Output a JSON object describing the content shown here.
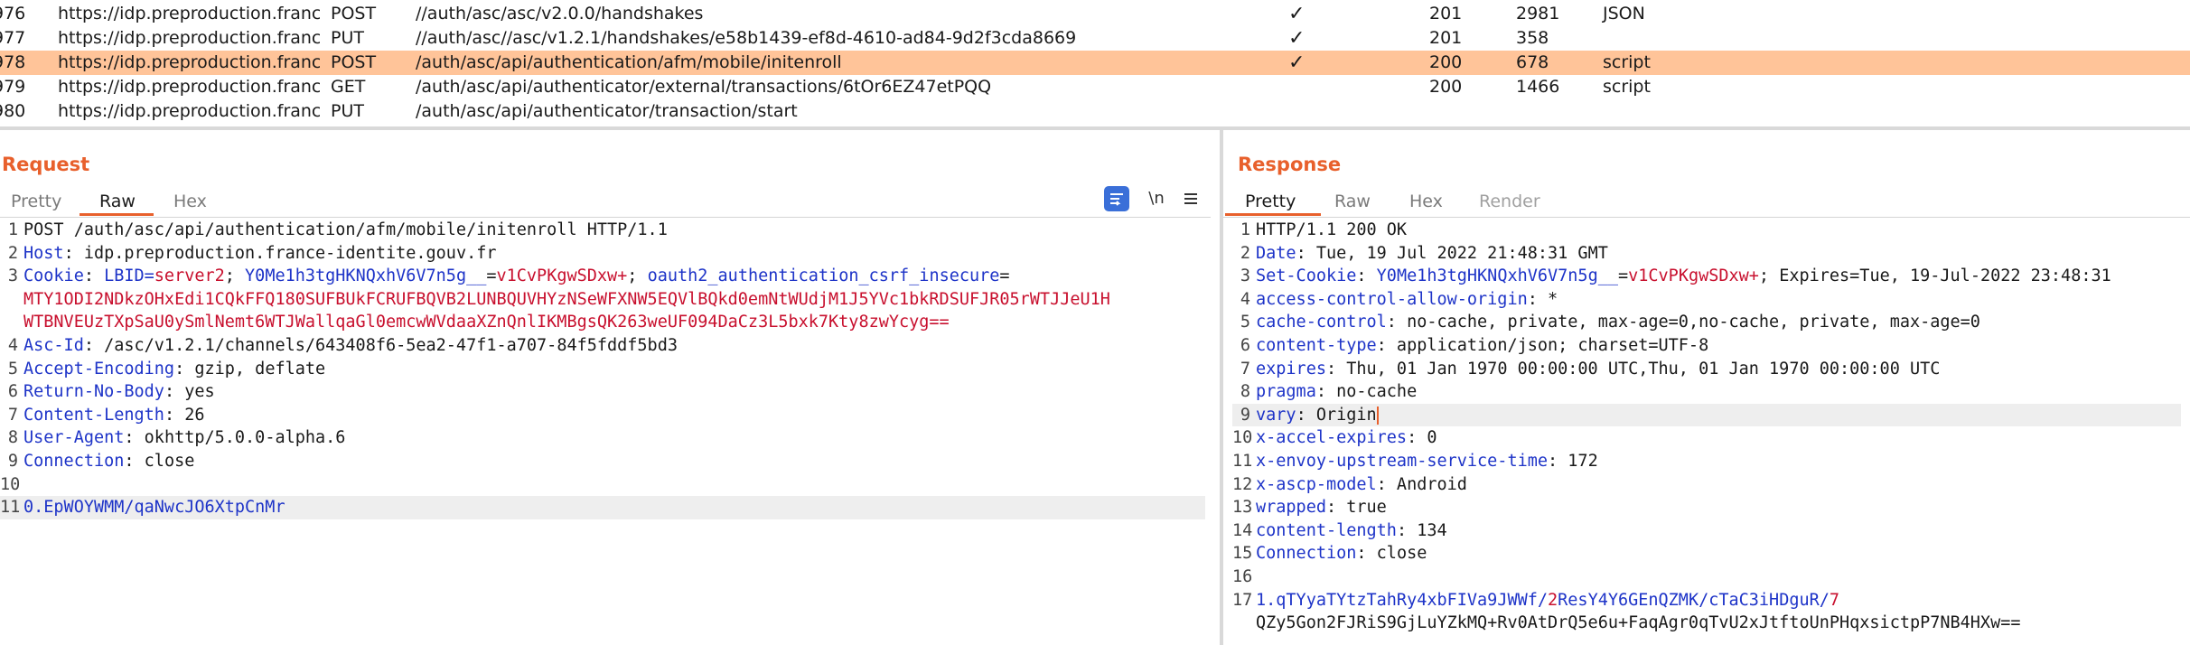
{
  "history": {
    "rows": [
      {
        "num": "976",
        "host": "https://idp.preproduction.franc...",
        "method": "POST",
        "url": "//auth/asc/asc/v2.0.0/handshakes",
        "edited": "✓",
        "status": "201",
        "length": "2981",
        "mime": "JSON"
      },
      {
        "num": "977",
        "host": "https://idp.preproduction.franc...",
        "method": "PUT",
        "url": "//auth/asc//asc/v1.2.1/handshakes/e58b1439-ef8d-4610-ad84-9d2f3cda8669",
        "edited": "✓",
        "status": "201",
        "length": "358",
        "mime": ""
      },
      {
        "num": "978",
        "host": "https://idp.preproduction.franc...",
        "method": "POST",
        "url": "/auth/asc/api/authentication/afm/mobile/initenroll",
        "edited": "✓",
        "status": "200",
        "length": "678",
        "mime": "script"
      },
      {
        "num": "979",
        "host": "https://idp.preproduction.franc...",
        "method": "GET",
        "url": "/auth/asc/api/authenticator/external/transactions/6tOr6EZ47etPQQ",
        "edited": "",
        "status": "200",
        "length": "1466",
        "mime": "script"
      },
      {
        "num": "980",
        "host": "https://idp.preproduction.franc...",
        "method": "PUT",
        "url": "/auth/asc/api/authenticator/transaction/start",
        "edited": "",
        "status": "",
        "length": "",
        "mime": ""
      }
    ]
  },
  "request": {
    "title": "Request",
    "tabs": [
      "Pretty",
      "Raw",
      "Hex"
    ],
    "icons": {
      "pretty": "pretty-print-icon",
      "newline": "\\n",
      "menu": "menu-icon"
    },
    "lines": {
      "l1": "POST /auth/asc/api/authentication/afm/mobile/initenroll HTTP/1.1",
      "l2k": "Host",
      "l2v": " idp.preproduction.france-identite.gouv.fr",
      "l3k": "Cookie",
      "l3a": " LBID=",
      "l3b": "server2",
      "l3c": "; ",
      "l3d": "Y0Me1h3tgHKNQxhV6V7n5g__",
      "l3e": "=",
      "l3f": "v1CvPKgwSDxw+",
      "l3g": "; ",
      "l3h": "oauth2_authentication_csrf_insecure",
      "l3i": "=",
      "l3w1": "MTY1ODI2NDkzOHxEdi1CQkFFQ180SUFBUkFCRUFBQVB2LUNBQUVHYzNSeWFXNW5EQVlBQkd0emNtWUdjM1J5YVc1bkRDSUFJR05rWTJJeU1H",
      "l3w2": "WTBNVEUzTXpSaU0ySmlNemt6WTJWallqaGl0emcwWVdaaXZnQnlIKMBgsQK263weUF094DaCz3L5bxk7Kty8zwYcyg==",
      "l4k": "Asc-Id",
      "l4v": " /asc/v1.2.1/channels/643408f6-5ea2-47f1-a707-84f5fddf5bd3",
      "l5k": "Accept-Encoding",
      "l5v": " gzip, deflate",
      "l6k": "Return-No-Body",
      "l6v": " yes",
      "l7k": "Content-Length",
      "l7v": " 26",
      "l8k": "User-Agent",
      "l8v": " okhttp/5.0.0-alpha.6",
      "l9k": "Connection",
      "l9v": " close",
      "l11": "0.EpWOYWMM/qaNwcJO6XtpCnMr"
    }
  },
  "response": {
    "title": "Response",
    "tabs": [
      "Pretty",
      "Raw",
      "Hex",
      "Render"
    ],
    "lines": {
      "l1": "HTTP/1.1 200 OK",
      "l2k": "Date",
      "l2v": " Tue, 19 Jul 2022 21:48:31 GMT",
      "l3k": "Set-Cookie",
      "l3a": " Y0Me1h3tgHKNQxhV6V7n5g__",
      "l3b": "=",
      "l3c": "v1CvPKgwSDxw+",
      "l3d": "; Expires=Tue, 19-Jul-2022 23:48:31",
      "l4k": "access-control-allow-origin",
      "l4v": " *",
      "l5k": "cache-control",
      "l5v": " no-cache, private, max-age=0,no-cache, private, max-age=0",
      "l6k": "content-type",
      "l6v": " application/json; charset=UTF-8",
      "l7k": "expires",
      "l7v": " Thu, 01 Jan 1970 00:00:00 UTC,Thu, 01 Jan 1970 00:00:00 UTC",
      "l8k": "pragma",
      "l8v": " no-cache",
      "l9k": "vary",
      "l9v": " Origin",
      "l10k": "x-accel-expires",
      "l10v": " 0",
      "l11k": "x-envoy-upstream-service-time",
      "l11v": " 172",
      "l12k": "x-ascp-model",
      "l12v": " Android",
      "l13k": "wrapped",
      "l13v": " true",
      "l14k": "content-length",
      "l14v": " 134",
      "l15k": "Connection",
      "l15v": " close",
      "l17a": "1.qTYyaTYtzTahRy4xbFIVa9JWWf/",
      "l17b": "2",
      "l17c": "ResY4Y6GEnQZMK/cTaC3iHDguR/",
      "l17d": "7",
      "l17w": "QZy5Gon2FJRiS9GjLuYZkMQ+Rv0AtDrQ5e6u+FaqAgr0qTvU2xJtftoUnPHqxsictpP7NB4HXw=="
    }
  }
}
